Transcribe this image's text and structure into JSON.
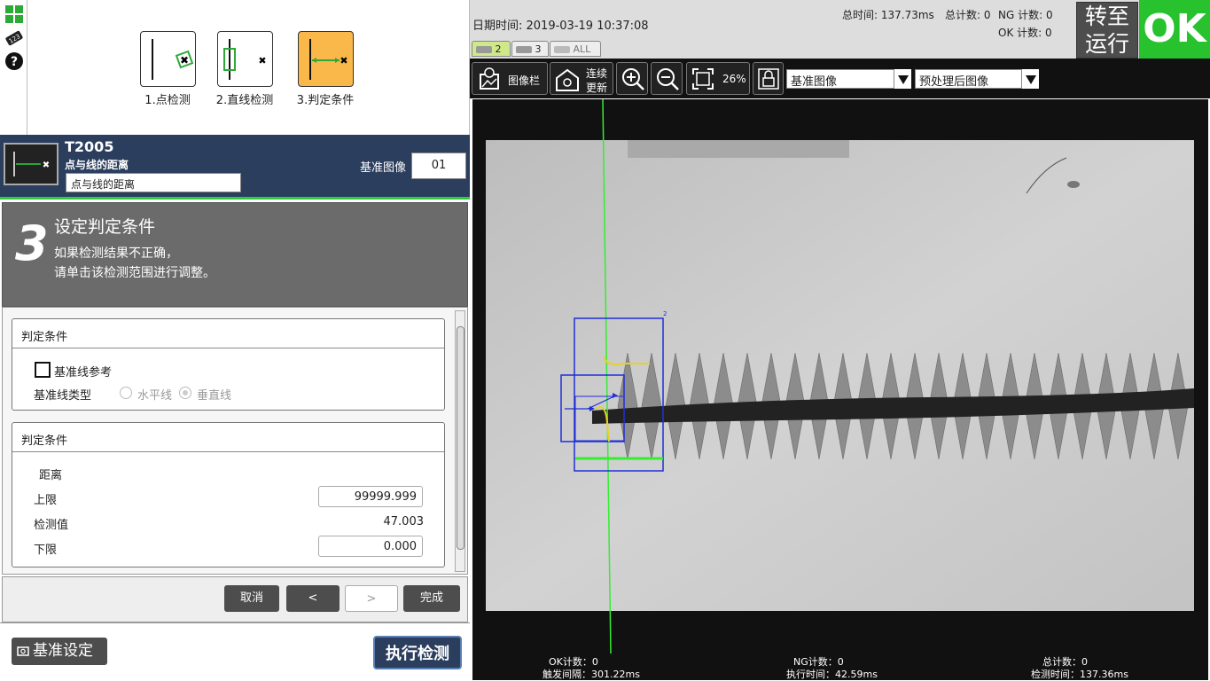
{
  "steps": [
    {
      "label": "1.点检测"
    },
    {
      "label": "2.直线检测"
    },
    {
      "label": "3.判定条件"
    }
  ],
  "header": {
    "id": "T2005",
    "type": "点与线的距离",
    "name_value": "点与线的距离",
    "ref_label": "基准图像",
    "ref_value": "01"
  },
  "step_panel": {
    "number": "3",
    "title": "设定判定条件",
    "desc_line1": "如果检测结果不正确，",
    "desc_line2": "请单击该检测范围进行调整。"
  },
  "group1": {
    "title": "判定条件",
    "checkbox_label": "基准线参考",
    "line_type_label": "基准线类型",
    "option_horizontal": "水平线",
    "option_vertical": "垂直线"
  },
  "group2": {
    "title": "判定条件",
    "section": "距离",
    "upper_label": "上限",
    "upper_value": "99999.999",
    "measured_label": "检测值",
    "measured_value": "47.003",
    "lower_label": "下限",
    "lower_value": "0.000"
  },
  "nav": {
    "cancel": "取消",
    "prev": "<",
    "next": ">",
    "finish": "完成"
  },
  "bottom": {
    "base_settings": "基准设定",
    "execute": "执行检测"
  },
  "topbar": {
    "datetime": "日期时间: 2019-03-19 10:37:08",
    "total_time": "总时间: 137.73ms",
    "total_count": "总计数: 0",
    "ng_count": "NG 计数: 0",
    "ok_count": "OK 计数: 0",
    "goto_run_line1": "转至",
    "goto_run_line2": "运行",
    "result": "OK"
  },
  "camera_tabs": [
    "2",
    "3",
    "ALL"
  ],
  "toolbar": {
    "image_bar": "图像栏",
    "continuous_line1": "连续",
    "continuous_line2": "更新",
    "zoom": "26%",
    "select1": "基准图像",
    "select2": "预处理后图像"
  },
  "overlay": {
    "region_tag": "2"
  },
  "status": {
    "ok_count": "OK计数：0",
    "trigger_interval": "触发间隔：301.22ms",
    "ng_count": "NG计数：0",
    "exec_time": "执行时间：42.59ms",
    "total_count": "总计数：0",
    "detect_time": "检测时间：137.36ms"
  },
  "colors": {
    "header_bg": "#2b3e5e",
    "active_step": "#fbb84a",
    "ok_green": "#27c22e",
    "overlay_blue": "#1f2fd6",
    "overlay_green": "#33ee33"
  }
}
